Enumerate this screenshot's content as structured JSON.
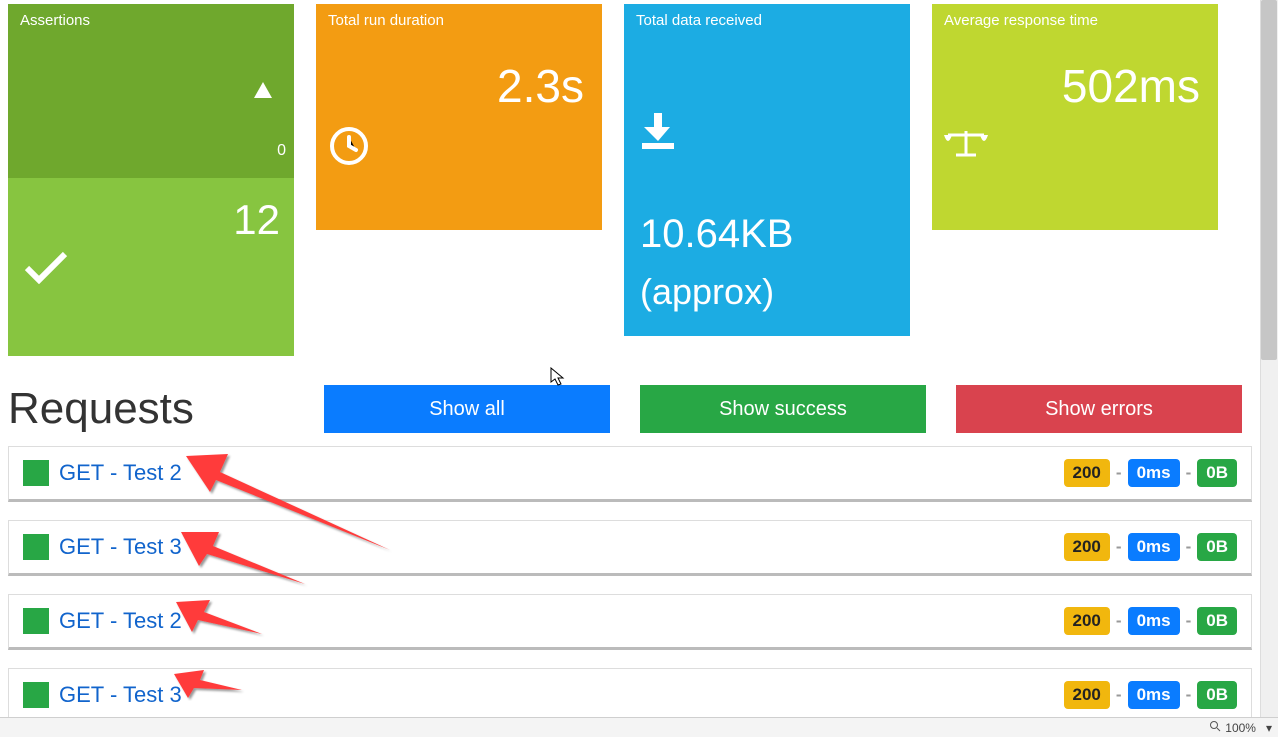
{
  "cards": {
    "assertions": {
      "title": "Assertions",
      "fail_count": "0",
      "pass_count": "12"
    },
    "duration": {
      "title": "Total run duration",
      "value": "2.3s"
    },
    "data": {
      "title": "Total data received",
      "value": "10.64KB",
      "approx": "(approx)"
    },
    "avg": {
      "title": "Average response time",
      "value": "502ms"
    }
  },
  "requests": {
    "heading": "Requests",
    "buttons": {
      "all": "Show all",
      "success": "Show success",
      "errors": "Show errors"
    },
    "items": [
      {
        "name": "GET - Test 2",
        "status": "200",
        "time": "0ms",
        "size": "0B"
      },
      {
        "name": "GET - Test 3",
        "status": "200",
        "time": "0ms",
        "size": "0B"
      },
      {
        "name": "GET - Test 2",
        "status": "200",
        "time": "0ms",
        "size": "0B"
      },
      {
        "name": "GET - Test 3",
        "status": "200",
        "time": "0ms",
        "size": "0B"
      }
    ]
  },
  "statusbar": {
    "zoom": "100%"
  }
}
